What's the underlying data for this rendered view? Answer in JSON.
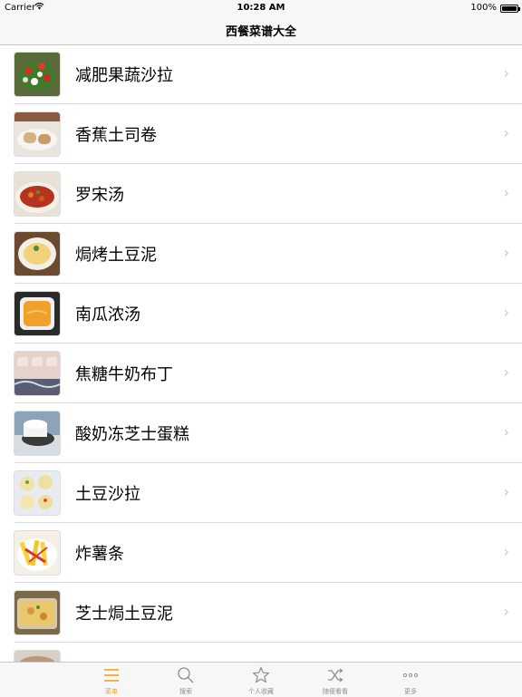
{
  "status_bar": {
    "carrier": "Carrier",
    "time": "10:28 AM",
    "battery": "100%"
  },
  "nav": {
    "title": "西餐菜谱大全"
  },
  "recipes": [
    {
      "label": "减肥果蔬沙拉",
      "thumb": "salad-photo"
    },
    {
      "label": "香蕉土司卷",
      "thumb": "toast-roll-photo"
    },
    {
      "label": "罗宋汤",
      "thumb": "borscht-photo"
    },
    {
      "label": "焗烤土豆泥",
      "thumb": "baked-mash-photo"
    },
    {
      "label": "南瓜浓汤",
      "thumb": "pumpkin-soup-photo"
    },
    {
      "label": "焦糖牛奶布丁",
      "thumb": "pudding-photo"
    },
    {
      "label": "酸奶冻芝士蛋糕",
      "thumb": "cheesecake-photo"
    },
    {
      "label": "土豆沙拉",
      "thumb": "potato-salad-photo"
    },
    {
      "label": "炸薯条",
      "thumb": "fries-photo"
    },
    {
      "label": "芝士焗土豆泥",
      "thumb": "cheese-mash-photo"
    }
  ],
  "tabs": [
    {
      "label": "菜单",
      "icon": "menu-icon",
      "active": true
    },
    {
      "label": "搜索",
      "icon": "search-icon",
      "active": false
    },
    {
      "label": "个人收藏",
      "icon": "star-icon",
      "active": false
    },
    {
      "label": "随便看看",
      "icon": "shuffle-icon",
      "active": false
    },
    {
      "label": "更多",
      "icon": "more-icon",
      "active": false
    }
  ],
  "colors": {
    "accent": "#f39c12",
    "bar_bg": "#f7f7f7",
    "chevron": "#c7c7cc"
  }
}
